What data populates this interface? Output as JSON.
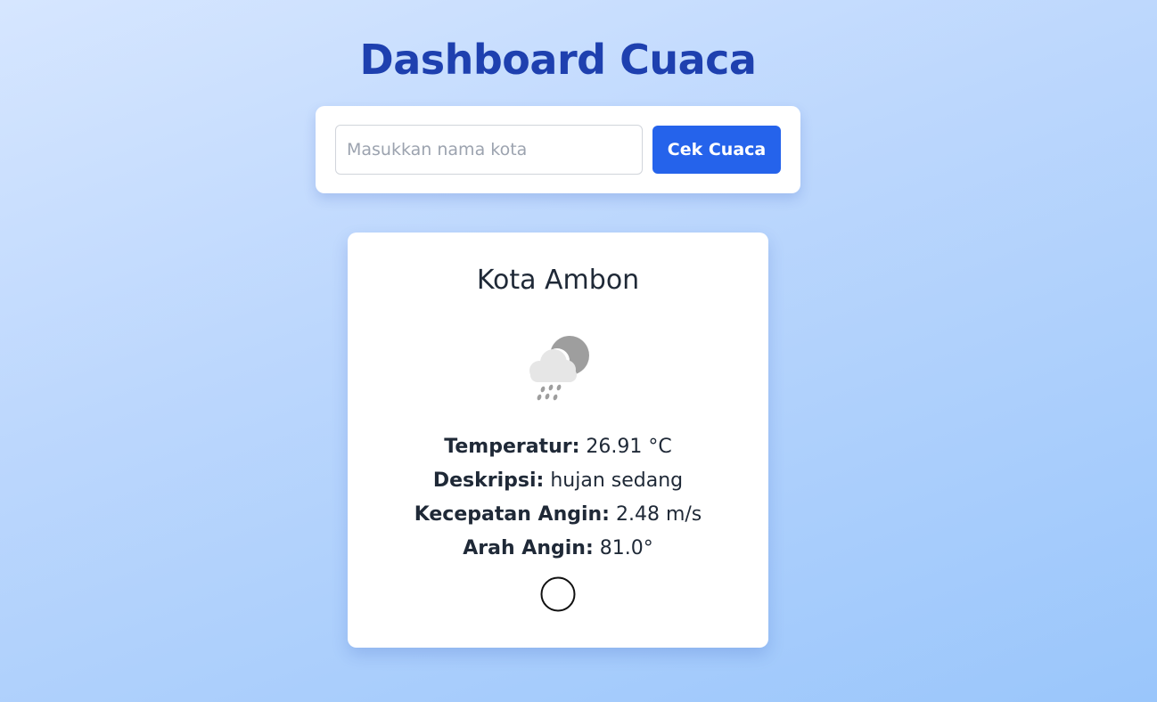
{
  "header": {
    "title": "Dashboard Cuaca"
  },
  "search": {
    "placeholder": "Masukkan nama kota",
    "value": "",
    "button_label": "Cek Cuaca"
  },
  "weather": {
    "city": "Kota Ambon",
    "icon": "rain-cloud-moon-icon",
    "rows": [
      {
        "label": "Temperatur:",
        "value": "26.91 °C"
      },
      {
        "label": "Deskripsi:",
        "value": "hujan sedang"
      },
      {
        "label": "Kecepatan Angin:",
        "value": "2.48 m/s"
      },
      {
        "label": "Arah Angin:",
        "value": "81.0°"
      }
    ],
    "wind_direction_deg": 81.0
  },
  "colors": {
    "title": "#1e40af",
    "button": "#2563eb",
    "text": "#1f2937"
  }
}
